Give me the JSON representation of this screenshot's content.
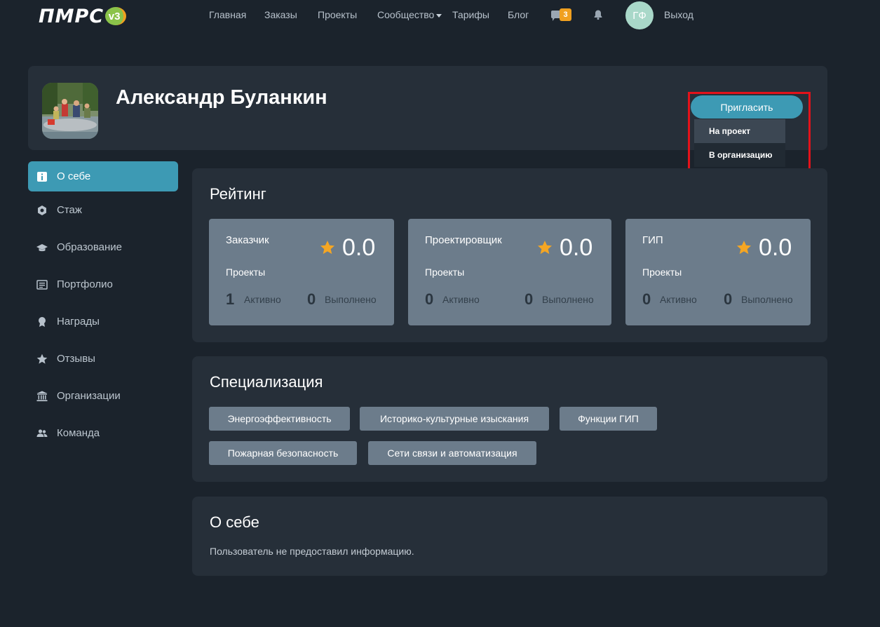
{
  "logo": {
    "text": "ПМРС",
    "badge": "v3"
  },
  "nav": {
    "items": [
      "Главная",
      "Заказы",
      "Проекты",
      "Сообщество",
      "Тарифы",
      "Блог"
    ],
    "messages_count": "3",
    "user_initials": "ГФ",
    "logout": "Выход"
  },
  "profile": {
    "name": "Александр Буланкин",
    "invite_button": "Пригласить",
    "invite_menu": [
      "На проект",
      "В организацию"
    ]
  },
  "sidebar": {
    "items": [
      {
        "label": "О себе",
        "icon": "info-icon",
        "active": true
      },
      {
        "label": "Стаж",
        "icon": "hexagon-icon"
      },
      {
        "label": "Образование",
        "icon": "graduation-cap-icon"
      },
      {
        "label": "Портфолио",
        "icon": "portfolio-icon"
      },
      {
        "label": "Награды",
        "icon": "award-icon"
      },
      {
        "label": "Отзывы",
        "icon": "star-icon"
      },
      {
        "label": "Организации",
        "icon": "institution-icon"
      },
      {
        "label": "Команда",
        "icon": "team-icon"
      }
    ]
  },
  "rating": {
    "title": "Рейтинг",
    "roles": [
      {
        "name": "Заказчик",
        "score": "0.0",
        "projects_label": "Проекты",
        "active_count": "1",
        "active_label": "Активно",
        "done_count": "0",
        "done_label": "Выполнено"
      },
      {
        "name": "Проектировщик",
        "score": "0.0",
        "projects_label": "Проекты",
        "active_count": "0",
        "active_label": "Активно",
        "done_count": "0",
        "done_label": "Выполнено"
      },
      {
        "name": "ГИП",
        "score": "0.0",
        "projects_label": "Проекты",
        "active_count": "0",
        "active_label": "Активно",
        "done_count": "0",
        "done_label": "Выполнено"
      }
    ]
  },
  "specialization": {
    "title": "Специализация",
    "tags": [
      "Энергоэффективность",
      "Историко-культурные изыскания",
      "Функции ГИП",
      "Пожарная безопасность",
      "Сети связи и автоматизация"
    ]
  },
  "about": {
    "title": "О себе",
    "text": "Пользователь не предоставил информацию."
  },
  "colors": {
    "page_bg": "#1b232c",
    "card_bg": "#262f39",
    "accent": "#3d9ab4",
    "role_box": "#6c7c8b",
    "star": "#f5a623",
    "badge": "#f0a020",
    "highlight": "#e3121a"
  }
}
